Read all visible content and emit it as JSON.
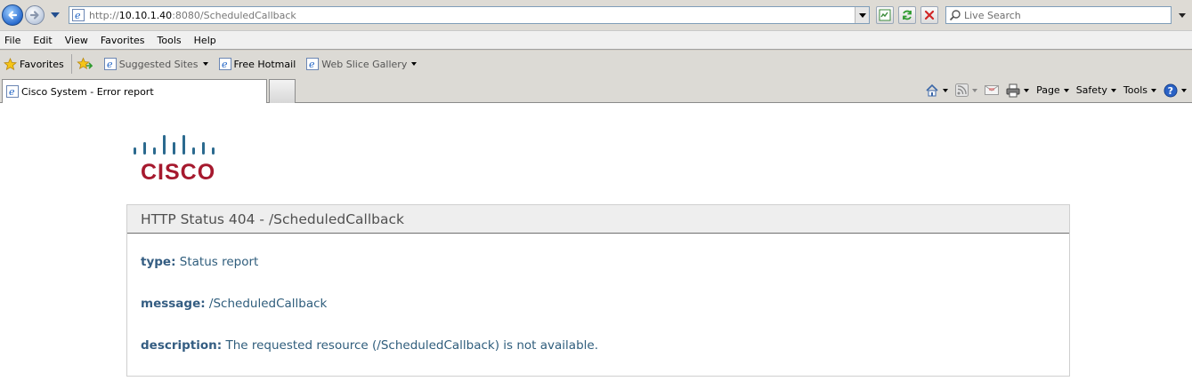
{
  "browser": {
    "address": {
      "scheme": "http://",
      "host": "10.10.1.40",
      "rest": ":8080/ScheduledCallback"
    },
    "search_placeholder": "Live Search",
    "menu": [
      "File",
      "Edit",
      "View",
      "Favorites",
      "Tools",
      "Help"
    ],
    "favorites_bar": {
      "favorites_label": "Favorites",
      "links": [
        {
          "label": "Suggested Sites",
          "has_menu": true
        },
        {
          "label": "Free Hotmail",
          "has_menu": false
        },
        {
          "label": "Web Slice Gallery",
          "has_menu": true
        }
      ]
    },
    "tab_title": "Cisco System - Error report",
    "command_bar": {
      "page_label": "Page",
      "safety_label": "Safety",
      "tools_label": "Tools"
    }
  },
  "page": {
    "logo_word": "CISCO",
    "error_title": "HTTP Status 404 - /ScheduledCallback",
    "type_key": "type:",
    "type_value": "Status report",
    "message_key": "message:",
    "message_value": "/ScheduledCallback",
    "description_key": "description:",
    "description_value": "The requested resource (/ScheduledCallback) is not available."
  },
  "colors": {
    "cisco_red": "#a6192e",
    "cisco_blue": "#2b6a8f",
    "info_text": "#2f5d7c"
  }
}
